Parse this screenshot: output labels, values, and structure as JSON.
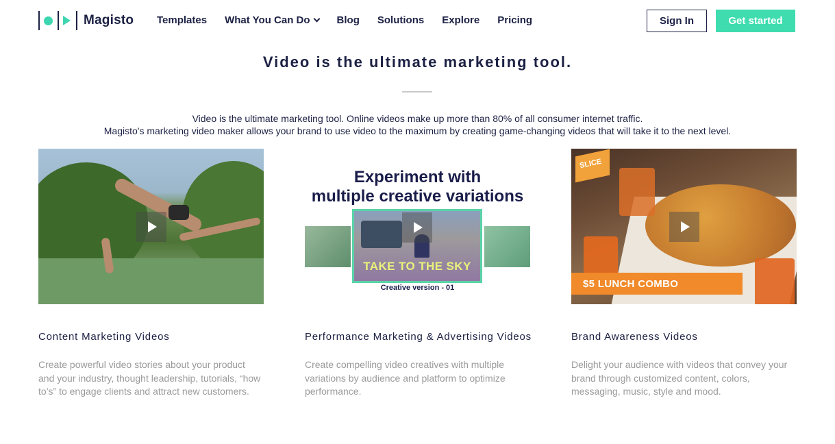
{
  "header": {
    "brand": "Magisto",
    "nav": [
      {
        "label": "Templates"
      },
      {
        "label": "What You Can Do",
        "has_dropdown": true
      },
      {
        "label": "Blog"
      },
      {
        "label": "Solutions"
      },
      {
        "label": "Explore"
      },
      {
        "label": "Pricing"
      }
    ],
    "sign_in_label": "Sign In",
    "get_started_label": "Get started"
  },
  "hero": {
    "title": "Video is the ultimate marketing tool.",
    "desc_line1": "Video is the ultimate marketing tool. Online videos make up more than 80% of all consumer internet traffic.",
    "desc_line2": "Magisto's marketing video maker allows your brand to use video to the maximum by creating game-changing videos that will take it to the next level."
  },
  "cards": [
    {
      "title": "Content Marketing Videos",
      "text": "Create powerful video stories about your product and your industry, thought leadership, tutorials, “how to’s” to engage clients and attract new customers."
    },
    {
      "title": "Performance Marketing & Advertising Videos",
      "text": "Create compelling video creatives with multiple variations by audience and platform to optimize performance.",
      "media": {
        "headline_1": "Experiment with",
        "headline_2": "multiple creative variations",
        "overlay": "TAKE TO THE SKY",
        "caption": "Creative version - 01"
      }
    },
    {
      "title": "Brand Awareness Videos",
      "text": "Delight your audience with videos that convey your brand through customized content, colors, messaging, music, style and mood.",
      "media": {
        "badge": "SLICE",
        "banner": "$5 LUNCH COMBO"
      }
    }
  ],
  "colors": {
    "brand_navy": "#1c2144",
    "brand_green": "#3fdcb0",
    "muted_text": "#9a9a9a"
  }
}
